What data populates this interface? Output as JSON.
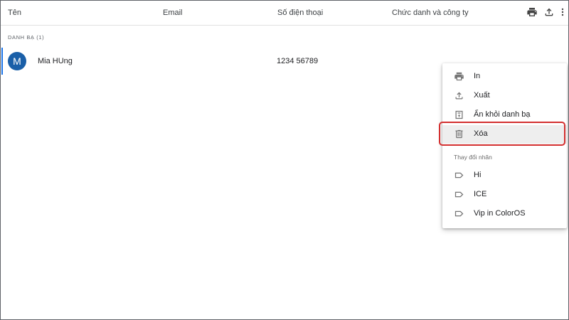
{
  "header": {
    "col_name": "Tên",
    "col_email": "Email",
    "col_phone": "Số điện thoại",
    "col_title": "Chức danh và công ty",
    "icons": [
      "print-icon",
      "export-icon",
      "more-vert-icon"
    ]
  },
  "contacts": {
    "section_label": "DANH BẠ (1)",
    "rows": [
      {
        "avatar_letter": "M",
        "name": "Mia HUng",
        "phone": "1234 56789"
      }
    ]
  },
  "menu": {
    "items": [
      {
        "icon": "print-icon",
        "label": "In"
      },
      {
        "icon": "export-icon",
        "label": "Xuất"
      },
      {
        "icon": "hide-contact-icon",
        "label": "Ẩn khỏi danh bạ"
      },
      {
        "icon": "trash-icon",
        "label": "Xóa"
      }
    ],
    "labels_heading": "Thay đổi nhãn",
    "labels": [
      {
        "icon": "label-icon",
        "label": "Hi"
      },
      {
        "icon": "label-icon",
        "label": "ICE"
      },
      {
        "icon": "label-icon",
        "label": "Vip in ColorOS"
      }
    ]
  },
  "colors": {
    "avatar": "#1a5fa8",
    "selection_bar": "#1a73e8",
    "highlight_border": "#d32f2f",
    "icon_gray": "#757575"
  }
}
